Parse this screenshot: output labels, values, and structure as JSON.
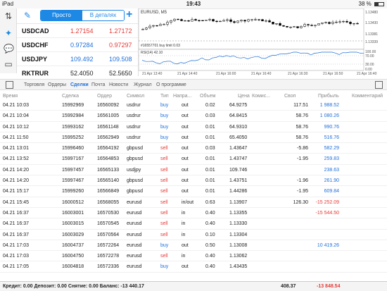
{
  "status": {
    "device": "iPad",
    "time": "19:43",
    "battery": "38 %"
  },
  "quotes": {
    "modes": [
      "Просто",
      "В деталях"
    ],
    "rows": [
      {
        "symbol": "USDCAD",
        "bid": "1.27154",
        "ask": "1.27172",
        "dir": "red"
      },
      {
        "symbol": "USDCHF",
        "bid": "0.97284",
        "ask": "0.97297",
        "dir": "blue"
      },
      {
        "symbol": "USDJPY",
        "bid": "109.492",
        "ask": "109.508",
        "dir": "blue"
      },
      {
        "symbol": "RKTRUR",
        "bid": "52.4050",
        "ask": "52.5650",
        "dir": "black"
      }
    ]
  },
  "chart": {
    "title": "EURUSD, M5",
    "order_label": "#16557701 buy limit 0.03",
    "indicator": "RSI(14) 42.10",
    "price_labels": [
      "1.13480",
      "1.13430",
      "1.13381",
      "1.13339"
    ],
    "rsi_labels": [
      "100.00",
      "70.00",
      "30.00",
      "0.00"
    ],
    "time_labels": [
      "21 Apr 13:40",
      "21 Apr 14:40",
      "21 Apr 16:00",
      "21 Apr 16:40",
      "21 Apr 16:30",
      "21 Apr 16:50",
      "21 Apr 16:40"
    ]
  },
  "tabs": [
    "Торговля",
    "Ордеры",
    "Сделки",
    "Почта",
    "Новости",
    "Журнал",
    "О программе"
  ],
  "active_tab": "Сделки",
  "table": {
    "headers": [
      "Время",
      "Сделка",
      "Ордер",
      "Символ",
      "Тип",
      "Напра...",
      "Объем",
      "Цена",
      "Комис...",
      "Своп",
      "Прибыль",
      "Комментарий"
    ],
    "rows": [
      [
        "04.21 10:03",
        "15992969",
        "16560092",
        "usdrur",
        "buy",
        "out",
        "0.02",
        "64.9275",
        "",
        "117.51",
        "1 988.52"
      ],
      [
        "04.21 10:04",
        "15992984",
        "16561005",
        "usdrur",
        "buy",
        "out",
        "0.03",
        "64.8415",
        "",
        "58.76",
        "1 080.26"
      ],
      [
        "04.21 10:12",
        "15993162",
        "16561148",
        "usdrur",
        "buy",
        "out",
        "0.01",
        "64.9310",
        "",
        "58.76",
        "990.76"
      ],
      [
        "04.21 11:50",
        "15995252",
        "16562949",
        "usdrur",
        "buy",
        "out",
        "0.01",
        "65.4050",
        "",
        "58.76",
        "516.76"
      ],
      [
        "04.21 13:01",
        "15996460",
        "16564192",
        "gbpusd",
        "sell",
        "out",
        "0.03",
        "1.43647",
        "",
        "-5.86",
        "582.29"
      ],
      [
        "04.21 13:52",
        "15997167",
        "16564853",
        "gbpusd",
        "sell",
        "out",
        "0.01",
        "1.43747",
        "",
        "-1.95",
        "259.83"
      ],
      [
        "04.21 14:20",
        "15997457",
        "16565133",
        "usdjpy",
        "sell",
        "out",
        "0.01",
        "109.746",
        "",
        "",
        "238.63"
      ],
      [
        "04.21 14:20",
        "15997467",
        "16565140",
        "gbpusd",
        "sell",
        "out",
        "0.01",
        "1.43751",
        "",
        "-1.96",
        "261.90"
      ],
      [
        "04.21 15:17",
        "15999260",
        "16566849",
        "gbpusd",
        "sell",
        "out",
        "0.01",
        "1.44286",
        "",
        "-1.95",
        "609.84"
      ],
      [
        "04.21 15:45",
        "16000512",
        "16568055",
        "eurusd",
        "sell",
        "in/out",
        "0.63",
        "1.13907",
        "",
        "126.30",
        "-15 252.09"
      ],
      [
        "04.21 16:37",
        "16003001",
        "16570530",
        "eurusd",
        "sell",
        "in",
        "0.40",
        "1.13355",
        "",
        "",
        "-15 544.50"
      ],
      [
        "04.21 16:37",
        "16003015",
        "16570545",
        "eurusd",
        "sell",
        "in",
        "0.40",
        "1.13330",
        "",
        "",
        ""
      ],
      [
        "04.21 16:37",
        "16003029",
        "16570564",
        "eurusd",
        "sell",
        "in",
        "0.10",
        "1.13304",
        "",
        "",
        ""
      ],
      [
        "04.21 17:03",
        "16004737",
        "16572264",
        "eurusd",
        "buy",
        "out",
        "0.50",
        "1.13008",
        "",
        "",
        "10 419.26"
      ],
      [
        "04.21 17:03",
        "16004750",
        "16572278",
        "eurusd",
        "sell",
        "in",
        "0.40",
        "1.13062",
        "",
        "",
        ""
      ],
      [
        "04.21 17:05",
        "16004818",
        "16572336",
        "eurusd",
        "buy",
        "out",
        "0.40",
        "1.43435",
        "",
        "",
        ""
      ]
    ]
  },
  "footer": {
    "summary": "Кредит: 0.00 Депозит: 0.00 Снятие: 0.00 Баланс: -13 440.17",
    "swap_total": "408.37",
    "profit_total": "-13 848.54"
  }
}
